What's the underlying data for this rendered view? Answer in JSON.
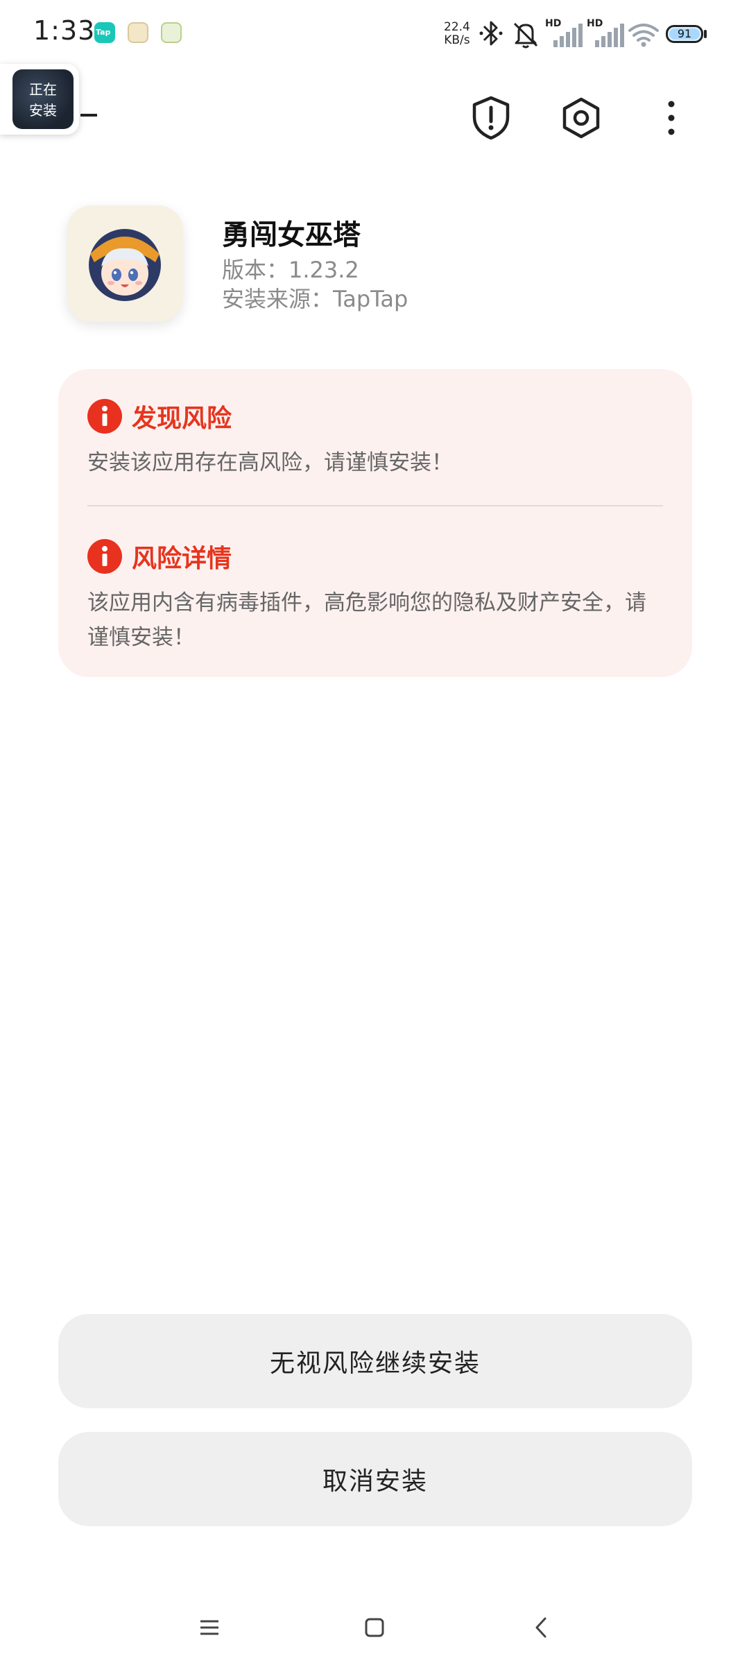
{
  "status_bar": {
    "time": "1:33",
    "net_speed_value": "22.4",
    "net_speed_unit": "KB/s",
    "signal_1_label": "HD",
    "signal_2_label": "HD",
    "battery_level": "91",
    "battery_fraction": 0.91,
    "notification_icons": [
      "taptap-icon",
      "game-icon",
      "leaf-icon"
    ]
  },
  "install_bubble": {
    "text": "正在\n安装"
  },
  "top_actions": {
    "icons": [
      "shield-alert-icon",
      "settings-hexagon-icon",
      "more-vertical-icon"
    ]
  },
  "app": {
    "name": "勇闯女巫塔",
    "version": "版本：1.23.2",
    "source": "安装来源：TapTap"
  },
  "risk": {
    "found_title": "发现风险",
    "found_desc": "安装该应用存在高风险，请谨慎安装！",
    "detail_title": "风险详情",
    "detail_desc": "该应用内含有病毒插件，高危影响您的隐私及财产安全，请谨慎安装！",
    "accent_color": "#e5351f",
    "card_color": "#fdf1ef"
  },
  "buttons": {
    "continue_label": "无视风险继续安装",
    "cancel_label": "取消安装"
  },
  "nav_bar": {
    "icons": [
      "menu-icon",
      "home-icon",
      "back-icon"
    ]
  }
}
